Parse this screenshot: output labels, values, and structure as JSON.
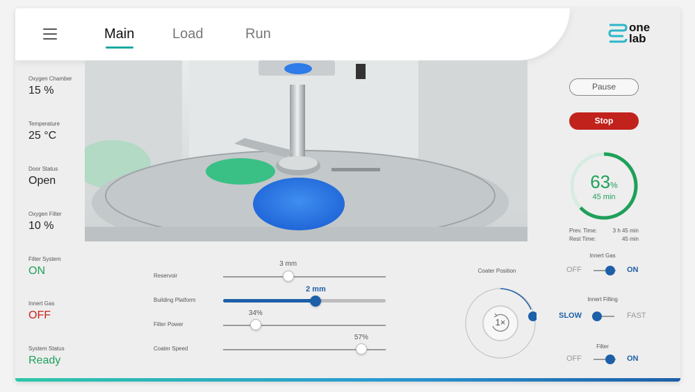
{
  "nav": {
    "tabs": [
      {
        "label": "Main"
      },
      {
        "label": "Load"
      },
      {
        "label": "Run"
      }
    ]
  },
  "logo": {
    "line1": "one",
    "line2": "lab"
  },
  "status": [
    {
      "label": "Oxygen Chamber",
      "value": "15 %"
    },
    {
      "label": "Temperature",
      "value": "25 °C"
    },
    {
      "label": "Door Status",
      "value": "Open"
    },
    {
      "label": "Oxygen Filter",
      "value": "10 %"
    },
    {
      "label": "Filter System",
      "value": "ON"
    },
    {
      "label": "Innert Gas",
      "value": "OFF"
    },
    {
      "label": "System Status",
      "value": "Ready"
    }
  ],
  "controls": {
    "pause_label": "Pause",
    "stop_label": "Stop"
  },
  "progress": {
    "percent": "63",
    "percent_unit": "%",
    "fraction": 0.63,
    "remaining": "45 min",
    "prev_time_label": "Prev. Time:",
    "prev_time_value": "3 h 45 min",
    "rest_time_label": "Rest Time:",
    "rest_time_value": "45 min"
  },
  "sliders": [
    {
      "label": "Reservoir",
      "value": "3 mm",
      "fraction": 0.4
    },
    {
      "label": "Building Platform",
      "value": "2 mm",
      "fraction": 0.57
    },
    {
      "label": "Filter Power",
      "value": "34%",
      "fraction": 0.2
    },
    {
      "label": "Coater Speed",
      "value": "57%",
      "fraction": 0.85
    }
  ],
  "coater": {
    "title": "Coater Position",
    "value": "1×"
  },
  "toggles": [
    {
      "title": "Innert Gas",
      "left": "OFF",
      "right": "ON",
      "state": "right"
    },
    {
      "title": "Innert Filling",
      "left": "SLOW",
      "right": "FAST",
      "state": "left"
    },
    {
      "title": "Filter",
      "left": "OFF",
      "right": "ON",
      "state": "right"
    }
  ],
  "colors": {
    "accent_green": "#1fa05a",
    "accent_blue": "#1d5fa8",
    "stop_red": "#c1221c",
    "tab_underline": "#1ca9a0"
  }
}
